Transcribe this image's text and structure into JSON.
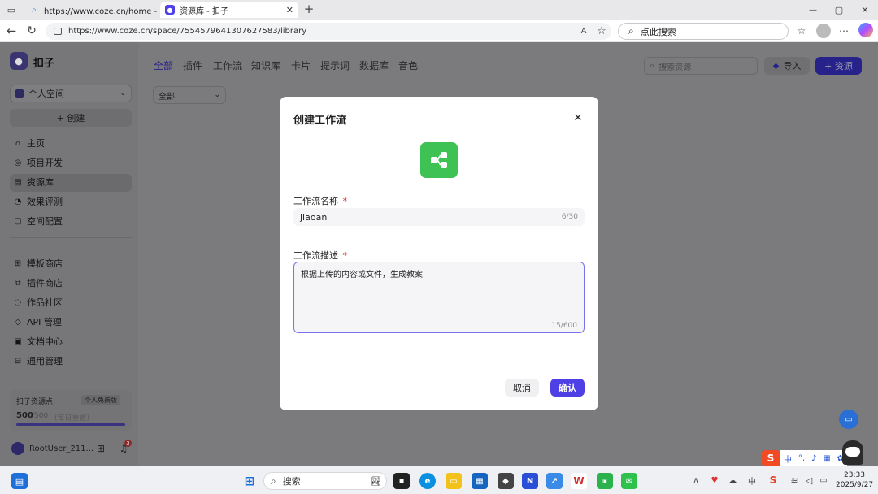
{
  "browser": {
    "tabs": [
      {
        "title": "https://www.coze.cn/home - 搜索",
        "close": "✕"
      },
      {
        "title": "资源库 - 扣子",
        "close": "✕"
      }
    ],
    "new_tab": "+",
    "url": "https://www.coze.cn/space/7554579641307627583/library",
    "search_placeholder": "点此搜索",
    "window_controls": {
      "minimize": "—",
      "maximize": "▢",
      "close": "✕"
    }
  },
  "sidebar": {
    "brand": "扣子",
    "space": "个人空间",
    "create": "+ 创建",
    "nav": [
      {
        "label": "主页",
        "icon": "home-icon"
      },
      {
        "label": "项目开发",
        "icon": "project-icon"
      },
      {
        "label": "资源库",
        "icon": "library-icon"
      },
      {
        "label": "效果评测",
        "icon": "evaluation-icon"
      },
      {
        "label": "空间配置",
        "icon": "space-config-icon"
      }
    ],
    "nav2": [
      {
        "label": "模板商店",
        "icon": "template-icon"
      },
      {
        "label": "插件商店",
        "icon": "plugin-icon"
      },
      {
        "label": "作品社区",
        "icon": "community-icon"
      },
      {
        "label": "API 管理",
        "icon": "api-icon"
      },
      {
        "label": "文档中心",
        "icon": "doc-icon"
      },
      {
        "label": "通用管理",
        "icon": "manage-icon"
      }
    ],
    "points": {
      "title": "扣子资源点",
      "plan": "个人免费版",
      "value": "500",
      "total": "/500",
      "note": "(每日重置)",
      "fill_fraction": 1.0
    },
    "user": "RootUser_211...",
    "notification_count": "3"
  },
  "main": {
    "tabs": [
      "全部",
      "插件",
      "工作流",
      "知识库",
      "卡片",
      "提示词",
      "数据库",
      "音色"
    ],
    "search_placeholder": "搜索资源",
    "import": "导入",
    "resource": "+ 资源",
    "filter": "全部"
  },
  "modal": {
    "title": "创建工作流",
    "close": "✕",
    "name_label": "工作流名称",
    "required_mark": "*",
    "name_value": "jiaoan",
    "name_count": "6/30",
    "desc_label": "工作流描述",
    "desc_value": "根据上传的内容或文件，生成教案",
    "desc_count": "15/600",
    "cancel": "取消",
    "confirm": "确认",
    "accent": "#4e40e5",
    "icon_color": "#3ec254"
  },
  "taskbar": {
    "search": "搜索",
    "ime": "中",
    "time": "23:33",
    "date": "2025/9/27"
  }
}
